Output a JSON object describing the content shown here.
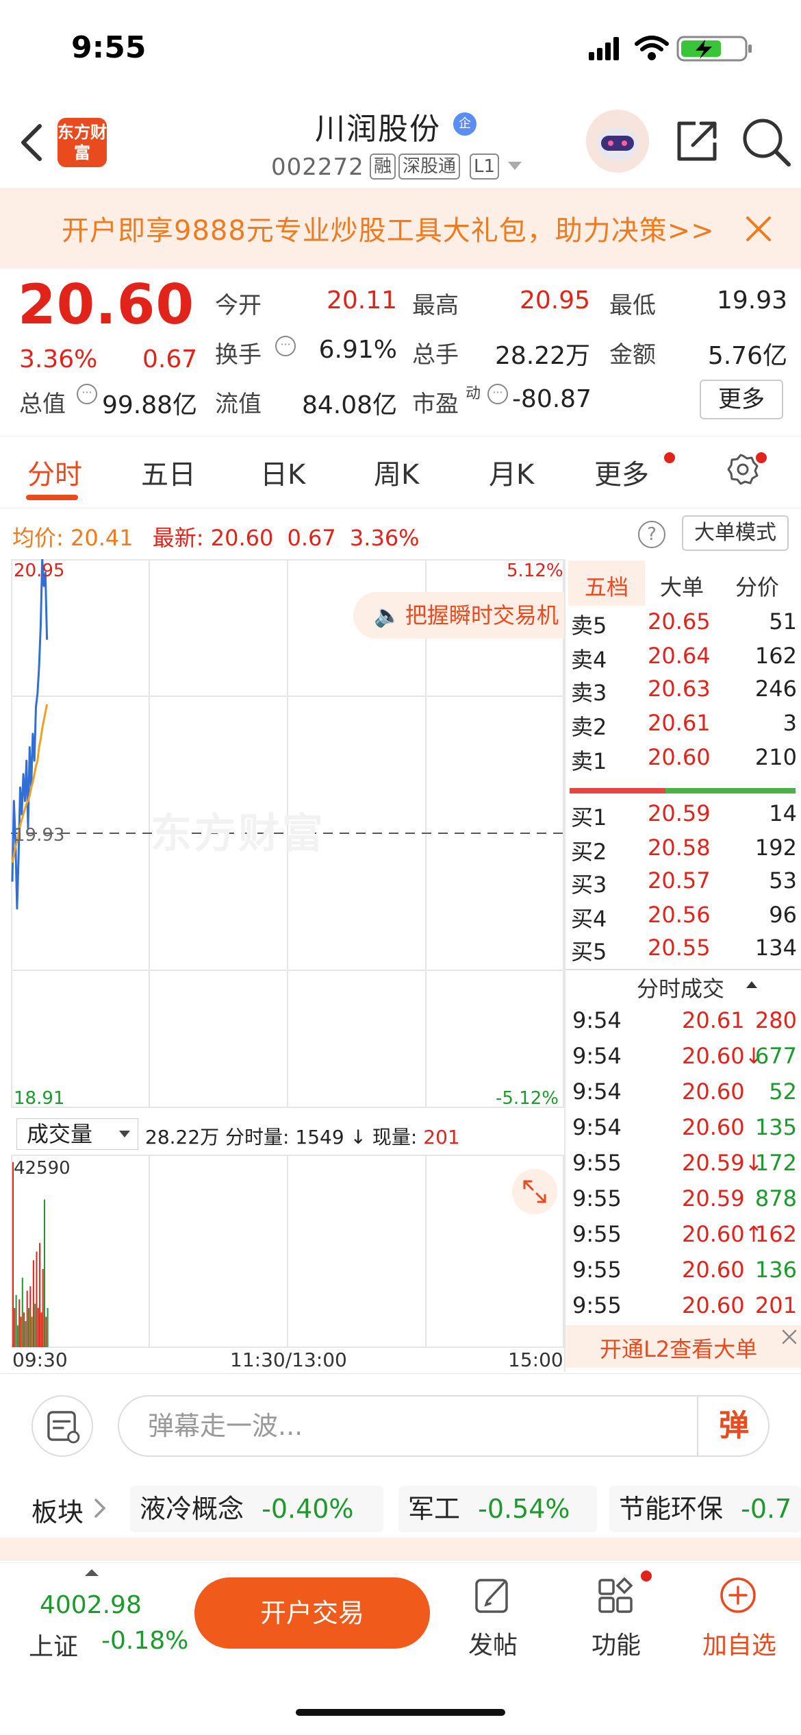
{
  "status_bar": {
    "time": "9:55"
  },
  "header": {
    "logo_text": "东方财富",
    "stock_name": "川润股份",
    "qi_badge": "企",
    "stock_code": "002272",
    "tags": [
      "融",
      "深股通",
      "L1"
    ]
  },
  "banner": {
    "text": "开户即享9888元专业炒股工具大礼包，助力决策>>"
  },
  "quote": {
    "price": "20.60",
    "change_pct": "3.36%",
    "change": "0.67",
    "fields": [
      {
        "label": "今开",
        "value": "20.11",
        "color": "#e2231a"
      },
      {
        "label": "最高",
        "value": "20.95",
        "color": "#e2231a"
      },
      {
        "label": "最低",
        "value": "19.93",
        "color": "#222222"
      },
      {
        "label": "换手",
        "value": "6.91%",
        "color": "#222222"
      },
      {
        "label": "总手",
        "value": "28.22万",
        "color": "#222222"
      },
      {
        "label": "金额",
        "value": "5.76亿",
        "color": "#222222"
      },
      {
        "label": "总值",
        "value": "99.88亿",
        "color": "#222222"
      },
      {
        "label": "流值",
        "value": "84.08亿",
        "color": "#222222"
      },
      {
        "label": "市盈",
        "value": "-80.87",
        "color": "#222222"
      }
    ],
    "pe_superscript": "动",
    "more_label": "更多"
  },
  "tabs": [
    "分时",
    "五日",
    "日K",
    "周K",
    "月K",
    "更多"
  ],
  "info_line": {
    "avg_label": "均价:",
    "avg_value": "20.41",
    "last_label": "最新:",
    "last_value": "20.60",
    "last_change": "0.67",
    "last_pct": "3.36%",
    "help": "?",
    "big_order_mode": "大单模式"
  },
  "chart": {
    "promo": "把握瞬时交易机",
    "watermark": "东方财富",
    "axis": {
      "top_price": "20.95",
      "mid_price": "19.93",
      "bottom_price": "18.91",
      "top_pct": "5.12%",
      "bottom_pct": "-5.12%",
      "vol_max": "42590"
    },
    "volume_selector": "成交量",
    "volume_info_prefix": "28.22万 分时量: 1549 ↓ 现量: ",
    "volume_info_now": "201",
    "time_labels": [
      "09:30",
      "11:30/13:00",
      "15:00"
    ]
  },
  "chart_data": {
    "type": "line",
    "title": "",
    "ylim": [
      18.91,
      20.95
    ],
    "xlabel": "",
    "ylabel": "",
    "series": [
      {
        "color": "#2f6fd6",
        "values": [
          19.75,
          20.05,
          19.9,
          19.65,
          19.85,
          20.1,
          20.0,
          20.15,
          20.05,
          20.2,
          19.95,
          20.25,
          20.1,
          20.3,
          20.2,
          20.4,
          20.45,
          20.55,
          20.7,
          20.95,
          20.85,
          20.9,
          20.65
        ]
      },
      {
        "color": "#f0a020",
        "values": [
          19.82,
          19.85,
          19.88,
          19.9,
          19.93,
          19.96,
          19.98,
          20.0,
          20.02,
          20.04,
          20.05,
          20.07,
          20.1,
          20.12,
          20.15,
          20.18,
          20.2,
          20.25,
          20.28,
          20.32,
          20.35,
          20.38,
          20.41
        ]
      }
    ],
    "volume": [
      42590,
      9000,
      12000,
      5000,
      11000,
      7000,
      16000,
      8000,
      6000,
      13000,
      9000,
      14000,
      7000,
      20000,
      10000,
      22000,
      9000,
      24000,
      8000,
      18000,
      34000,
      7000,
      9000
    ]
  },
  "order_book": {
    "tabs": [
      "五档",
      "大单",
      "分价"
    ],
    "asks": [
      {
        "label": "卖5",
        "price": "20.65",
        "vol": "51"
      },
      {
        "label": "卖4",
        "price": "20.64",
        "vol": "162"
      },
      {
        "label": "卖3",
        "price": "20.63",
        "vol": "246"
      },
      {
        "label": "卖2",
        "price": "20.61",
        "vol": "3"
      },
      {
        "label": "卖1",
        "price": "20.60",
        "vol": "210"
      }
    ],
    "bids": [
      {
        "label": "买1",
        "price": "20.59",
        "vol": "14"
      },
      {
        "label": "买2",
        "price": "20.58",
        "vol": "192"
      },
      {
        "label": "买3",
        "price": "20.57",
        "vol": "53"
      },
      {
        "label": "买4",
        "price": "20.56",
        "vol": "96"
      },
      {
        "label": "买5",
        "price": "20.55",
        "vol": "134"
      }
    ]
  },
  "ticks": {
    "title": "分时成交",
    "rows": [
      {
        "time": "9:54",
        "price": "20.61",
        "vol": "280",
        "pc": "red",
        "vc": "red"
      },
      {
        "time": "9:54",
        "price": "20.60↓",
        "vol": "677",
        "pc": "red",
        "vc": "green"
      },
      {
        "time": "9:54",
        "price": "20.60",
        "vol": "52",
        "pc": "red",
        "vc": "green"
      },
      {
        "time": "9:54",
        "price": "20.60",
        "vol": "135",
        "pc": "red",
        "vc": "green"
      },
      {
        "time": "9:55",
        "price": "20.59↓",
        "vol": "172",
        "pc": "red",
        "vc": "green"
      },
      {
        "time": "9:55",
        "price": "20.59",
        "vol": "878",
        "pc": "red",
        "vc": "green"
      },
      {
        "time": "9:55",
        "price": "20.60↑",
        "vol": "162",
        "pc": "red",
        "vc": "red"
      },
      {
        "time": "9:55",
        "price": "20.60",
        "vol": "136",
        "pc": "red",
        "vc": "green"
      },
      {
        "time": "9:55",
        "price": "20.60",
        "vol": "201",
        "pc": "red",
        "vc": "red"
      }
    ],
    "l2_banner": "开通L2查看大单"
  },
  "comment": {
    "placeholder": "弹幕走一波...",
    "danmu": "弹"
  },
  "sectors": {
    "label": "板块",
    "items": [
      {
        "name": "液冷概念",
        "pct": "-0.40%"
      },
      {
        "name": "军工",
        "pct": "-0.54%"
      },
      {
        "name": "节能环保",
        "pct": "-0.7"
      }
    ]
  },
  "bottom_bar": {
    "index_value": "4002.98",
    "index_name": "上证",
    "index_change": "-0.18%",
    "trade_button": "开户交易",
    "post": "发帖",
    "function": "功能",
    "add_watch": "加自选"
  },
  "colors": {
    "up": "#e2231a",
    "down": "#1d9a2c",
    "accent": "#ea4b1e"
  }
}
